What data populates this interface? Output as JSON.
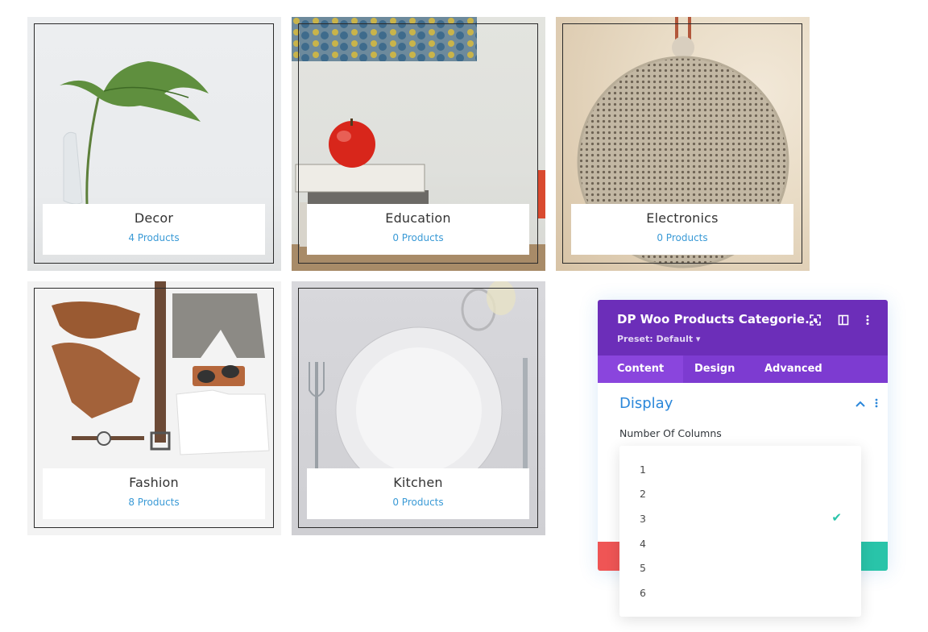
{
  "categories": [
    {
      "name": "Decor",
      "count": "4 Products"
    },
    {
      "name": "Education",
      "count": "0 Products"
    },
    {
      "name": "Electronics",
      "count": "0 Products"
    },
    {
      "name": "Fashion",
      "count": "8 Products"
    },
    {
      "name": "Kitchen",
      "count": "0 Products"
    }
  ],
  "panel": {
    "title": "DP Woo Products Categorie...",
    "preset": "Preset: Default ▾",
    "tabs": [
      "Content",
      "Design",
      "Advanced"
    ],
    "active_tab": "Content",
    "section_title": "Display",
    "field_label": "Number Of Columns",
    "options": [
      "1",
      "2",
      "3",
      "4",
      "5",
      "6"
    ],
    "selected_option": "3"
  },
  "colors": {
    "panel_header": "#6c2eb9",
    "tabs_bar": "#7d3bd1",
    "accent_blue": "#2b87da",
    "link_blue": "#3a9ad6",
    "check_teal": "#29c4a9",
    "cancel_red": "#ef5555"
  }
}
